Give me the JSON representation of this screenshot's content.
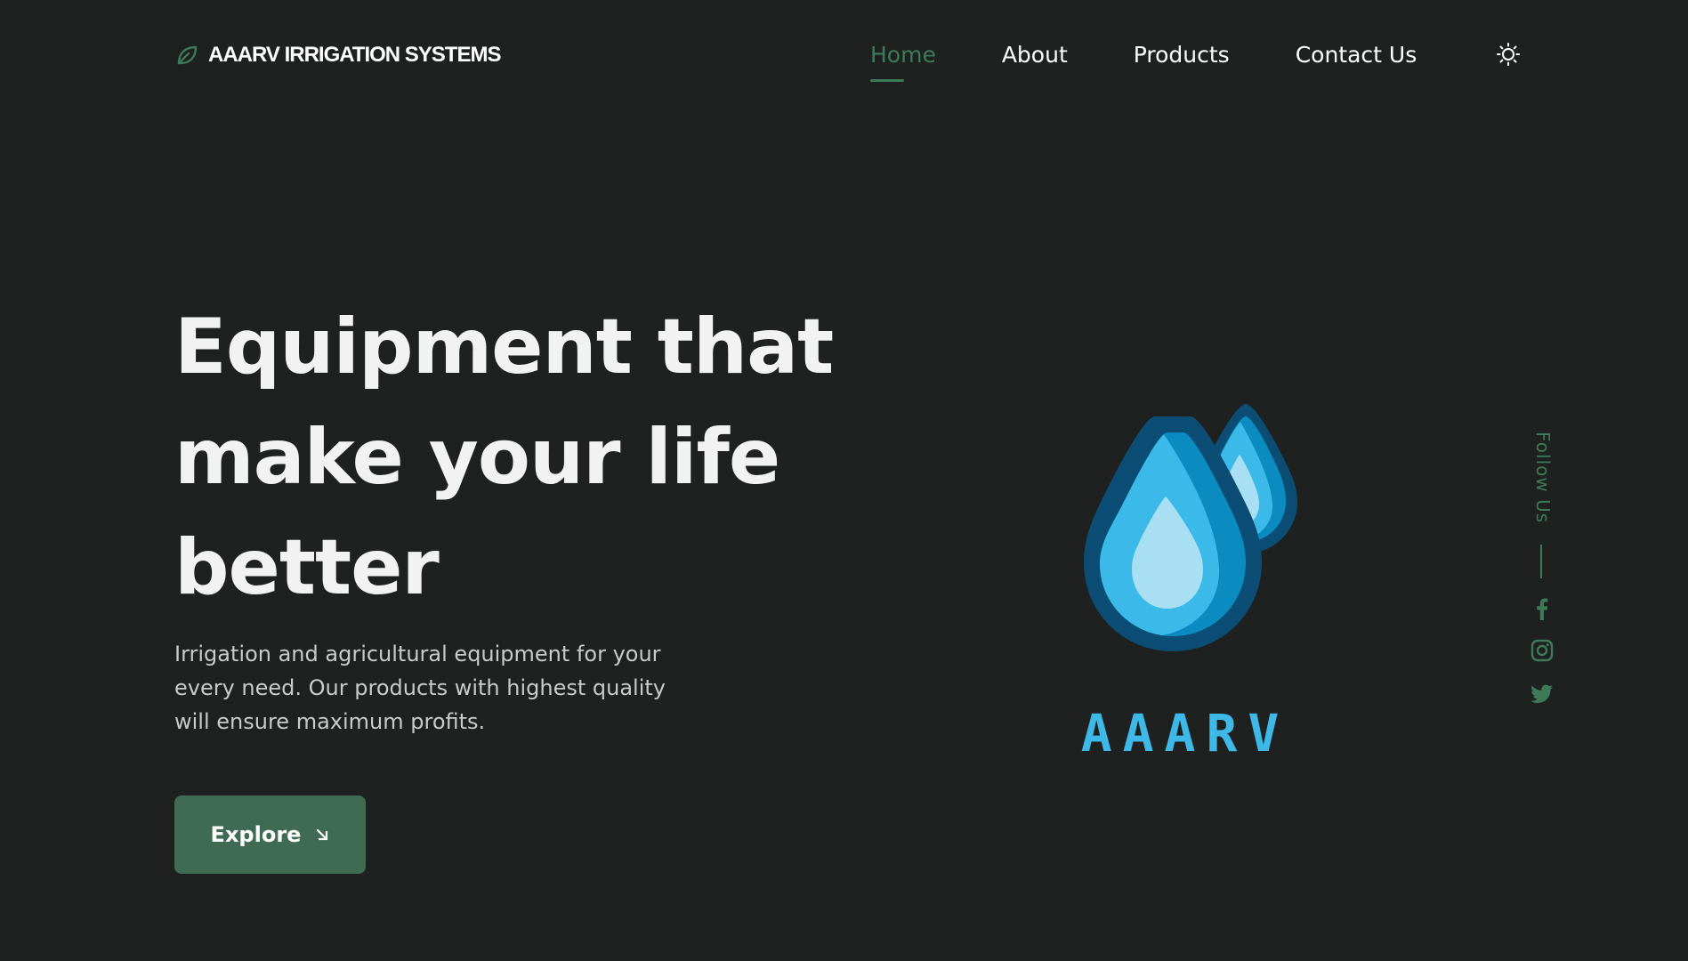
{
  "brand": {
    "name": "AAARV IRRIGATION SYSTEMS",
    "icon": "leaf-icon"
  },
  "nav": {
    "items": [
      {
        "label": "Home",
        "active": true
      },
      {
        "label": "About",
        "active": false
      },
      {
        "label": "Products",
        "active": false
      },
      {
        "label": "Contact Us",
        "active": false
      }
    ],
    "theme_toggle_icon": "sun-icon"
  },
  "hero": {
    "title_lines": [
      "Equipment that",
      "make your life",
      "better"
    ],
    "description_lines": [
      "Irrigation and agricultural equipment for your",
      "every need. Our products with highest quality",
      "will ensure maximum profits."
    ],
    "cta_label": "Explore",
    "cta_icon": "arrow-down-right-icon"
  },
  "logo": {
    "word": "AAARV",
    "icon": "water-drops-icon"
  },
  "social": {
    "label": "Follow Us",
    "links": [
      "facebook-icon",
      "instagram-icon",
      "twitter-icon"
    ]
  },
  "colors": {
    "background": "#1e2120",
    "accent": "#3e7a59",
    "button": "#3f6a54",
    "logo_text": "#3eb8e6"
  }
}
